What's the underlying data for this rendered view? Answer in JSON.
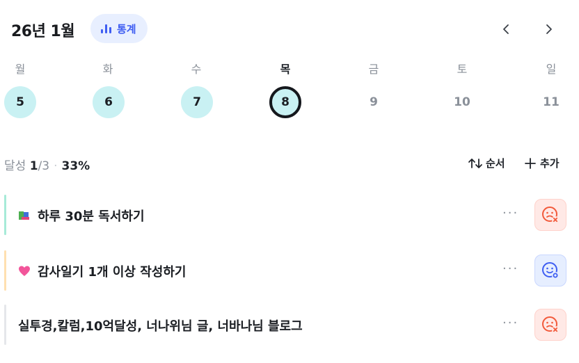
{
  "header": {
    "month_title": "26년 1월",
    "stats_label": "통계",
    "prev_icon": "chevron-left-icon",
    "next_icon": "chevron-right-icon"
  },
  "week": {
    "weekdays": [
      "월",
      "화",
      "수",
      "목",
      "금",
      "토",
      "일"
    ],
    "days": [
      {
        "day": "5",
        "state": "done"
      },
      {
        "day": "6",
        "state": "done"
      },
      {
        "day": "7",
        "state": "done"
      },
      {
        "day": "8",
        "state": "today"
      },
      {
        "day": "9",
        "state": "none"
      },
      {
        "day": "10",
        "state": "none"
      },
      {
        "day": "11",
        "state": "none"
      }
    ],
    "active_weekday": "목"
  },
  "summary": {
    "label": "달성",
    "done": "1",
    "total": "/3",
    "separator": "·",
    "percent": "33%"
  },
  "actions": {
    "sort_label": "순서",
    "add_label": "추가"
  },
  "tasks": [
    {
      "title": "하루 30분 독서하기",
      "emoji": "books-icon",
      "bar_color": "#a7ead8",
      "status": "fail",
      "more": "···"
    },
    {
      "title": "감사일기 1개 이상 작성하기",
      "emoji": "pink-heart-icon",
      "bar_color": "#ffe0b0",
      "status": "ok",
      "more": "···"
    },
    {
      "title": "실투경,칼럼,10억달성, 너나위님 글, 너바나님 블로그",
      "emoji": "",
      "bar_color": "#e5e7ea",
      "status": "fail",
      "more": "···"
    }
  ],
  "colors": {
    "accent": "#3e5df2",
    "done_day": "#c9f1f3",
    "fail": "#f2593a",
    "ok": "#3e5df2"
  }
}
